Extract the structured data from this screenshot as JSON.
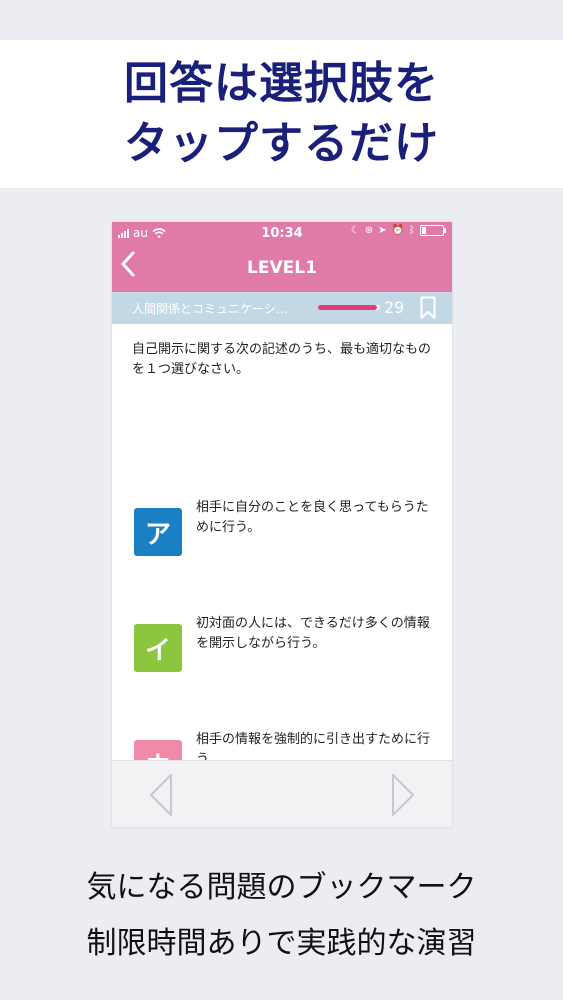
{
  "banner": {
    "line1": "回答は選択肢を",
    "line2": "タップするだけ"
  },
  "status": {
    "carrier": "au",
    "time": "10:34"
  },
  "nav": {
    "back_icon": "chevron-left-icon",
    "title": "LEVEL1"
  },
  "category": {
    "label": "人間関係とコミュニケーシ…",
    "progress_percent": 95,
    "count": "29"
  },
  "question": {
    "text": "自己開示に関する次の記述のうち、最も適切なものを１つ選びなさい。"
  },
  "choices": [
    {
      "label": "ア",
      "text": "相手に自分のことを良く思ってもらうために行う。",
      "color": "#1b7fc4"
    },
    {
      "label": "イ",
      "text": "初対面の人には、できるだけ多くの情報を開示しながら行う。",
      "color": "#8cc63f"
    },
    {
      "label": "ウ",
      "text": "相手の情報を強制的に引き出すために行う。",
      "color": "#f08aa8"
    }
  ],
  "colors": {
    "accent_pink": "#e07aa6",
    "category_bar": "#c3d8e5",
    "banner_text": "#1a1f7a"
  },
  "footer": {
    "line1": "気になる問題のブックマーク",
    "line2": "制限時間ありで実践的な演習"
  }
}
